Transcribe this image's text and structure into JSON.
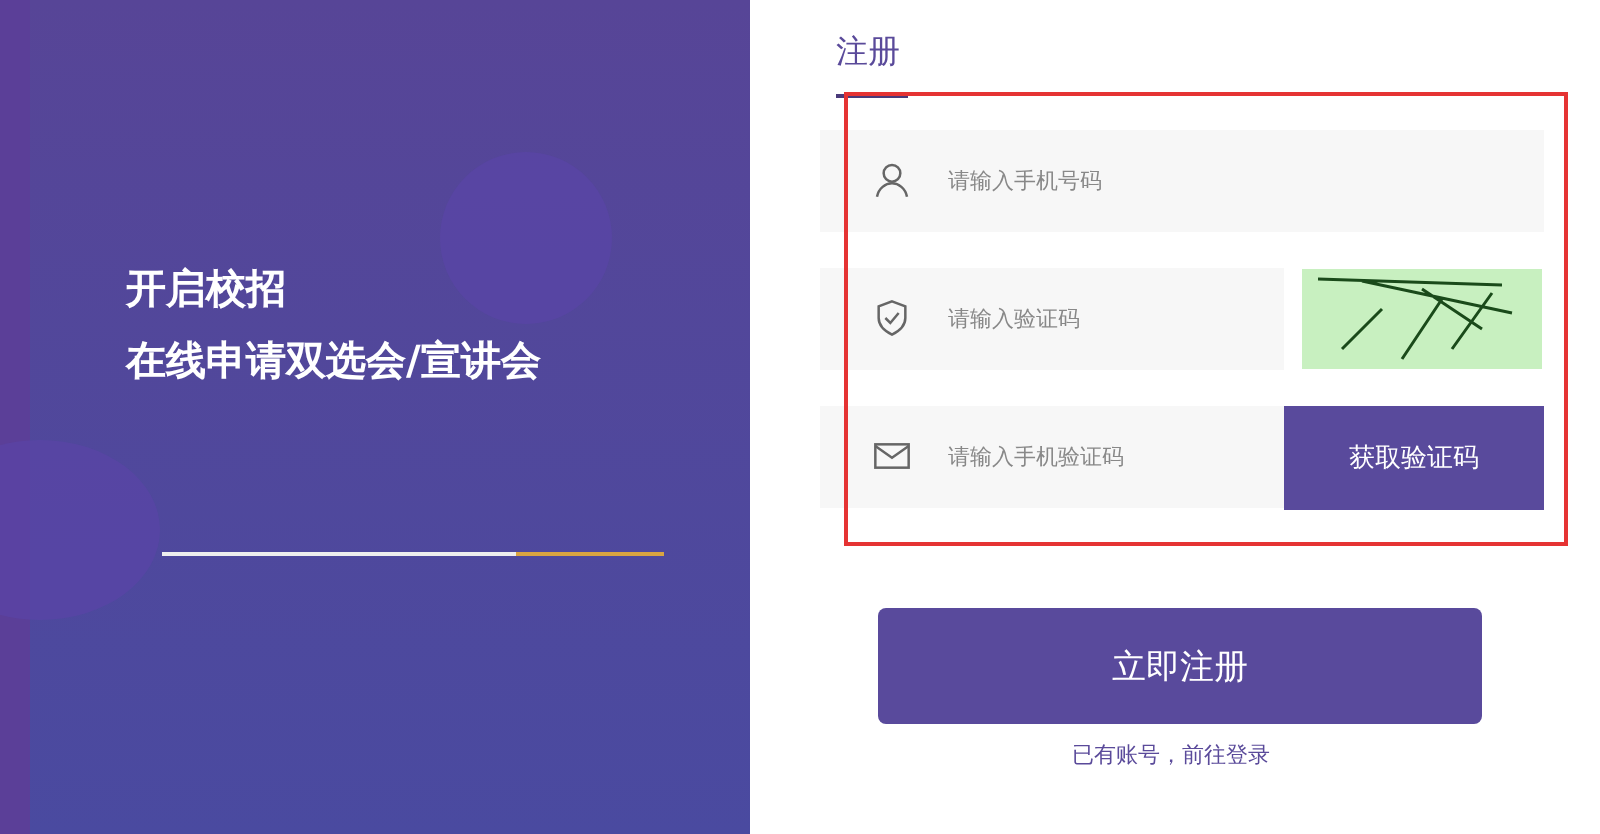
{
  "promo": {
    "lines": [
      "开启校招",
      "在线申请双选会/宣讲会"
    ]
  },
  "tabs": [
    {
      "label": "注册",
      "selected": true
    }
  ],
  "fields": [
    {
      "kind": "phone",
      "placeholder": "请输入手机号码"
    },
    {
      "kind": "captcha",
      "placeholder": "请输入验证码"
    },
    {
      "kind": "sms",
      "placeholder": "请输入手机验证码",
      "button": "获取验证码"
    }
  ],
  "submit": "立即注册",
  "login_link": "已有账号，前往登录"
}
